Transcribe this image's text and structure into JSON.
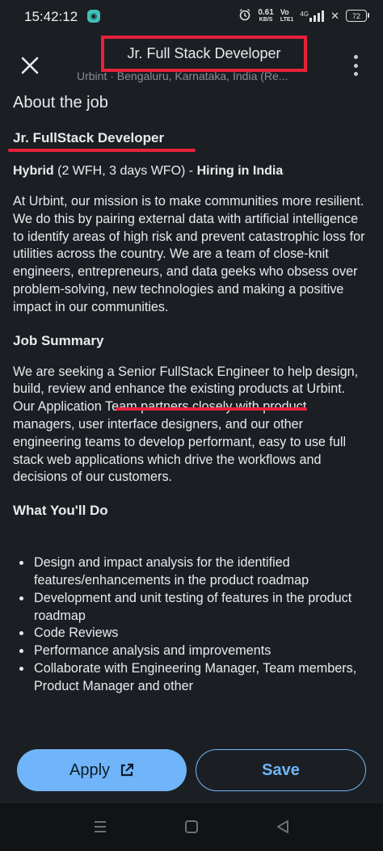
{
  "status_bar": {
    "time": "15:42:12",
    "app_badge": "◉",
    "speed_value": "0.61",
    "speed_unit": "KB/S",
    "volte_top": "Vo",
    "volte_bottom": "LTE1",
    "network": "4G",
    "battery": "72"
  },
  "header": {
    "job_title": "Jr. Full Stack Developer",
    "subtitle": "Urbint · Bengaluru, Karnataka, India (Re..."
  },
  "job": {
    "about_heading": "About the job",
    "role_title": "Jr. FullStack Developer",
    "hybrid_label": "Hybrid",
    "hybrid_detail": " (2 WFH, 3 days WFO) - ",
    "hiring_label": "Hiring in India",
    "intro_paragraph": "At Urbint, our mission is to make communities more resilient. We do this by pairing external data with artificial intelligence to identify areas of high risk and prevent catastrophic loss for utilities across the country. We are a team of close-knit engineers, entrepreneurs, and data geeks who obsess over problem-solving, new technologies and making a positive impact in our communities.",
    "summary_heading": "Job Summary",
    "summary_pre": "We are seeking ",
    "summary_highlight": "a Senior FullStack Engineer",
    "summary_post": " to help design, build, review and enhance the existing products at Urbint. Our Application Team partners closely with product managers, user interface designers, and our other engineering teams to develop performant, easy to use full stack web applications which drive the workflows and decisions of our customers.",
    "todo_heading": "What You'll Do",
    "todo_items": [
      "Design and impact analysis for the identified features/enhancements in the product roadmap",
      "Development and unit testing of features in the product roadmap",
      "Code Reviews",
      "Performance analysis and improvements",
      "Collaborate with Engineering Manager, Team members, Product Manager and other"
    ]
  },
  "actions": {
    "apply_label": "Apply",
    "save_label": "Save"
  },
  "colors": {
    "background": "#1b1f24",
    "accent": "#70b5f9",
    "annotation_red": "#e8213a"
  }
}
